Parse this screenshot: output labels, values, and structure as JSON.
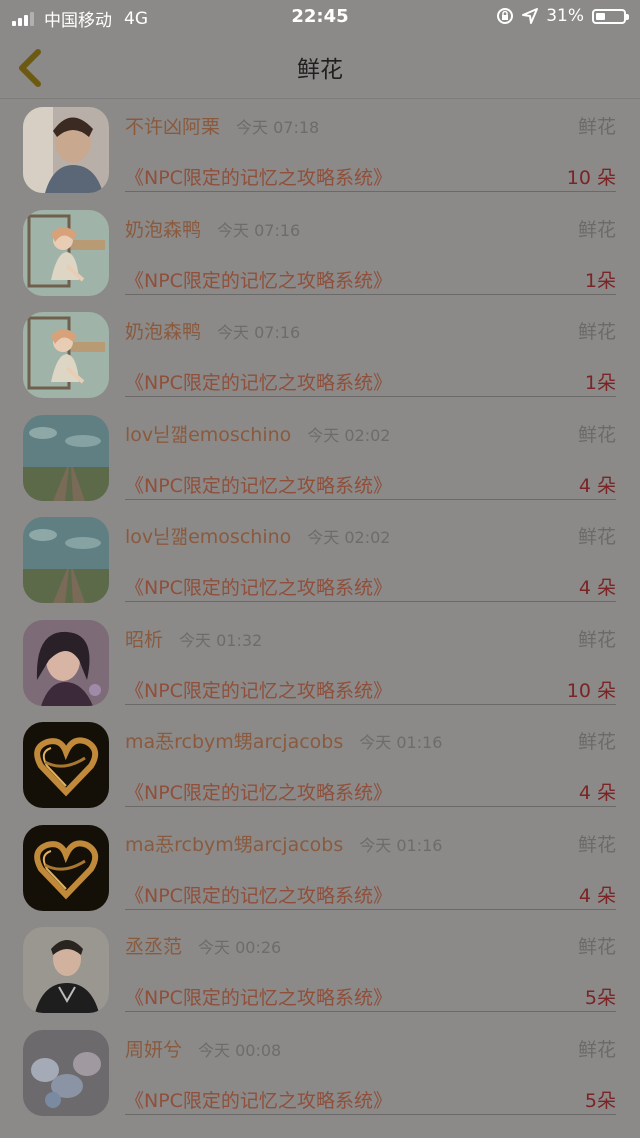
{
  "status": {
    "carrier": "中国移动",
    "network": "4G",
    "time": "22:45",
    "battery": "31%"
  },
  "nav": {
    "title": "鲜花",
    "back_icon": "chevron-left-icon"
  },
  "rows": [
    {
      "name": "不许凶阿栗",
      "time": "今天 07:18",
      "type": "鲜花",
      "book": "《NPC限定的记忆之攻略系统》",
      "count": "10 朵",
      "avatar": "boy-portrait"
    },
    {
      "name": "奶泡森鸭",
      "time": "今天 07:16",
      "type": "鲜花",
      "book": "《NPC限定的记忆之攻略系统》",
      "count": "1朵",
      "avatar": "cartoon-girl"
    },
    {
      "name": "奶泡森鸭",
      "time": "今天 07:16",
      "type": "鲜花",
      "book": "《NPC限定的记忆之攻略系统》",
      "count": "1朵",
      "avatar": "cartoon-girl"
    },
    {
      "name": "lov닏꺪emoschino",
      "time": "今天 02:02",
      "type": "鲜花",
      "book": "《NPC限定的记忆之攻略系统》",
      "count": "4 朵",
      "avatar": "railway-landscape"
    },
    {
      "name": "lov닏꺪emoschino",
      "time": "今天 02:02",
      "type": "鲜花",
      "book": "《NPC限定的记忆之攻略系统》",
      "count": "4 朵",
      "avatar": "railway-landscape"
    },
    {
      "name": "昭析",
      "time": "今天 01:32",
      "type": "鲜花",
      "book": "《NPC限定的记忆之攻略系统》",
      "count": "10 朵",
      "avatar": "girl-portrait"
    },
    {
      "name": "ma忢rcbym甥arcjacobs",
      "time": "今天 01:16",
      "type": "鲜花",
      "book": "《NPC限定的记忆之攻略系统》",
      "count": "4 朵",
      "avatar": "light-heart"
    },
    {
      "name": "ma忢rcbym甥arcjacobs",
      "time": "今天 01:16",
      "type": "鲜花",
      "book": "《NPC限定的记忆之攻略系统》",
      "count": "4 朵",
      "avatar": "light-heart"
    },
    {
      "name": "丞丞范",
      "time": "今天 00:26",
      "type": "鲜花",
      "book": "《NPC限定的记忆之攻略系统》",
      "count": "5朵",
      "avatar": "boy-portrait-dark"
    },
    {
      "name": "周妍兮",
      "time": "今天 00:08",
      "type": "鲜花",
      "book": "《NPC限定的记忆之攻略系统》",
      "count": "5朵",
      "avatar": "flowers-photo"
    }
  ]
}
